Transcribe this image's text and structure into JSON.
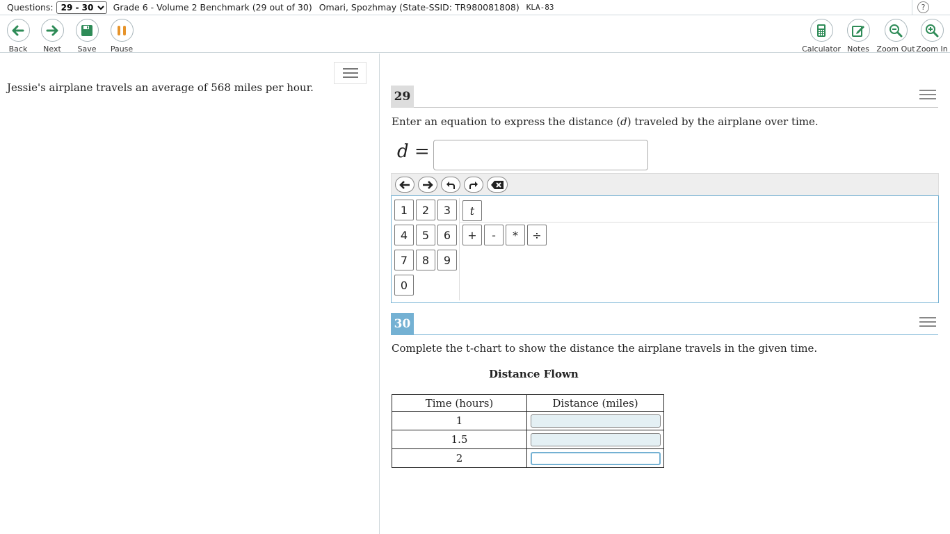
{
  "infobar": {
    "questions_label": "Questions:",
    "questions_selected": "29 - 30",
    "test_title": "Grade 6 - Volume 2 Benchmark (29 out of 30)",
    "student": "Omari, Spozhmay (State-SSID: TR980081808)",
    "code": "KLA-83",
    "help": "?"
  },
  "toolbar": {
    "back": "Back",
    "next": "Next",
    "save": "Save",
    "pause": "Pause",
    "calculator": "Calculator",
    "notes": "Notes",
    "zoom_out": "Zoom Out",
    "zoom_in": "Zoom In"
  },
  "colors": {
    "tool_green": "#2e8b57",
    "pause_orange": "#e6932a",
    "accent_blue": "#74b1d3"
  },
  "passage": {
    "text": "Jessie's airplane travels an average of 568 miles per hour."
  },
  "q29": {
    "number": "29",
    "prompt_before": "Enter an equation to express the distance (",
    "prompt_var": "d",
    "prompt_after": ") traveled by the airplane over time.",
    "equation_var": "d",
    "equation_eq": "=",
    "equation_value": "",
    "editor_buttons": [
      "arrow-left-icon",
      "arrow-right-icon",
      "undo-icon",
      "redo-icon",
      "backspace-icon"
    ],
    "keys": {
      "k1": "1",
      "k2": "2",
      "k3": "3",
      "k4": "4",
      "k5": "5",
      "k6": "6",
      "k7": "7",
      "k8": "8",
      "k9": "9",
      "k0": "0",
      "t": "t",
      "plus": "+",
      "minus": "-",
      "times": "*",
      "divide": "÷"
    }
  },
  "q30": {
    "number": "30",
    "prompt": "Complete the t-chart to show the distance the airplane travels in the given time.",
    "table_title": "Distance Flown",
    "headers": [
      "Time (hours)",
      "Distance (miles)"
    ],
    "rows": [
      {
        "time": "1",
        "distance": ""
      },
      {
        "time": "1.5",
        "distance": ""
      },
      {
        "time": "2",
        "distance": ""
      }
    ]
  }
}
